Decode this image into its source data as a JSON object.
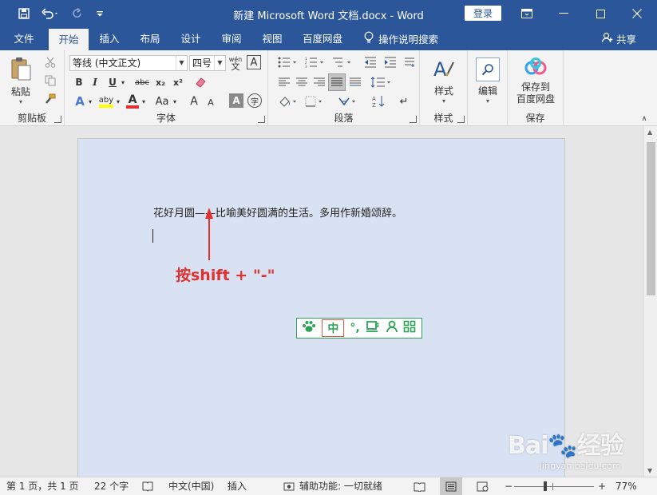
{
  "titlebar": {
    "doc_title": "新建 Microsoft Word 文档.docx  -  Word",
    "login_label": "登录",
    "save_icon": "save-icon",
    "undo_icon": "undo-icon",
    "redo_icon": "redo-icon"
  },
  "tabs": [
    {
      "label": "文件"
    },
    {
      "label": "开始"
    },
    {
      "label": "插入"
    },
    {
      "label": "布局"
    },
    {
      "label": "设计"
    },
    {
      "label": "审阅"
    },
    {
      "label": "视图"
    },
    {
      "label": "百度网盘"
    }
  ],
  "search_tab": {
    "label": "操作说明搜索"
  },
  "share": {
    "label": "共享"
  },
  "ribbon": {
    "clipboard": {
      "label": "剪贴板",
      "paste_label": "粘贴"
    },
    "font": {
      "label": "字体",
      "font_name": "等线 (中文正文)",
      "font_size": "四号",
      "wen_label": "wén",
      "wen_char": "文",
      "bold": "B",
      "italic": "I",
      "underline": "U",
      "strike": "abc",
      "sub": "x₂",
      "sup": "x²",
      "font_color": "A",
      "highlight": "aby",
      "case": "Aa",
      "grow": "A",
      "shrink": "A",
      "char_border": "A",
      "enclose": "字"
    },
    "paragraph": {
      "label": "段落"
    },
    "styles": {
      "label": "样式",
      "btn_label": "样式"
    },
    "editing": {
      "btn_label": "编辑"
    },
    "save": {
      "label": "保存",
      "btn_line1": "保存到",
      "btn_line2": "百度网盘"
    }
  },
  "document": {
    "line1": "花好月圆——比喻美好圆满的生活。多用作新婚颂辞。",
    "annotation": "按shift + \"-\""
  },
  "ime": {
    "mode": "中"
  },
  "statusbar": {
    "page": "第 1 页，共 1 页",
    "words": "22 个字",
    "language": "中文(中国)",
    "insert_mode": "插入",
    "accessibility": "辅助功能: 一切就绪",
    "zoom": "77%",
    "zoom_minus": "−",
    "zoom_plus": "+"
  },
  "watermark": {
    "text": "Bai🐾经验",
    "url": "jingyan.baidu.com"
  },
  "colors": {
    "brand": "#2b579a",
    "annotation": "#e0312f",
    "ime": "#2ea158"
  }
}
